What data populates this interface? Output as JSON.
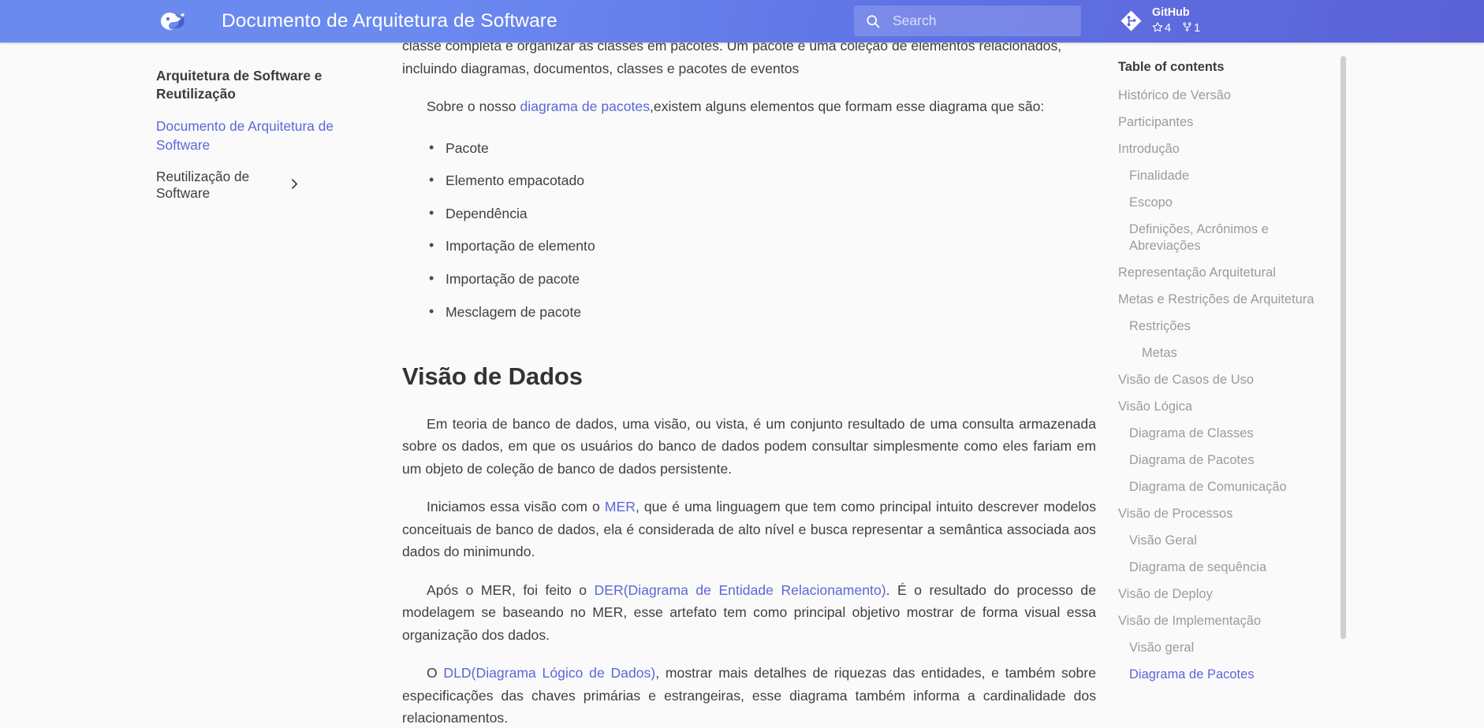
{
  "header": {
    "title": "Documento de Arquitetura de Software",
    "logo_icon": "yin-yang-logo-icon",
    "search": {
      "placeholder": "Search",
      "value": "",
      "icon": "search-icon"
    },
    "repo": {
      "icon": "git-diamond-icon",
      "name": "GitHub",
      "stars_icon": "star-icon",
      "stars": "4",
      "forks_icon": "fork-icon",
      "forks": "1"
    },
    "colors": {
      "gradient_start": "#6b8af0",
      "gradient_end": "#5b62d6",
      "text": "#ffffff"
    }
  },
  "sidebar": {
    "section_title": "Arquitetura de Software e Reutilização",
    "links": [
      {
        "label": "Documento de Arquitetura de Software",
        "active": true
      }
    ],
    "items": [
      {
        "label": "Reutilização de Software",
        "chevron": "chevron-right-icon"
      }
    ]
  },
  "main": {
    "clipped_line": "classe completa e organizar as classes em pacotes. Um pacote é uma coleção de elementos relacionados,",
    "para_continuation": "incluindo diagramas, documentos, classes e pacotes de eventos",
    "para_packages": {
      "before": "Sobre o nosso ",
      "link": "diagrama de pacotes",
      "after": ",existem alguns elementos que formam esse diagrama que são:"
    },
    "bullets": [
      "Pacote",
      "Elemento empacotado",
      "Dependência",
      "Importação de elemento",
      "Importação de pacote",
      "Mesclagem de pacote"
    ],
    "heading": "Visão de Dados",
    "paragraphs": [
      {
        "text": "Em teoria de banco de dados, uma visão, ou vista, é um conjunto resultado de uma consulta armazenada sobre os dados, em que os usuários do banco de dados podem consultar simplesmente como eles fariam em um objeto de coleção de banco de dados persistente."
      },
      {
        "before": "Iniciamos essa visão com o ",
        "link": "MER",
        "after": ", que é uma linguagem que tem como principal intuito descrever modelos conceituais de banco de dados, ela é considerada de alto nível e busca representar a semântica associada aos dados do minimundo."
      },
      {
        "before": "Após o MER, foi feito o ",
        "link": "DER(Diagrama de Entidade Relacionamento)",
        "after": ". É o resultado do processo de modelagem se baseando no MER, esse artefato tem como principal objetivo mostrar de forma visual essa organização dos dados."
      },
      {
        "before": "O ",
        "link": "DLD(Diagrama Lógico de Dados)",
        "after": ", mostrar mais detalhes de riquezas das entidades, e também sobre especificações das chaves primárias e estrangeiras, esse diagrama também informa a cardinalidade dos relacionamentos."
      }
    ]
  },
  "toc": {
    "title": "Table of contents",
    "items": [
      {
        "label": "Histórico de Versão",
        "level": 1,
        "active": false
      },
      {
        "label": "Participantes",
        "level": 1,
        "active": false
      },
      {
        "label": "Introdução",
        "level": 1,
        "active": false
      },
      {
        "label": "Finalidade",
        "level": 2,
        "active": false
      },
      {
        "label": "Escopo",
        "level": 2,
        "active": false
      },
      {
        "label": "Definições, Acrônimos e Abreviações",
        "level": 2,
        "active": false
      },
      {
        "label": "Representação Arquitetural",
        "level": 1,
        "active": false
      },
      {
        "label": "Metas e Restrições de Arquitetura",
        "level": 1,
        "active": false
      },
      {
        "label": "Restrições",
        "level": 2,
        "active": false
      },
      {
        "label": "Metas",
        "level": 3,
        "active": false
      },
      {
        "label": "Visão de Casos de Uso",
        "level": 1,
        "active": false
      },
      {
        "label": "Visão Lógica",
        "level": 1,
        "active": false
      },
      {
        "label": "Diagrama de Classes",
        "level": 2,
        "active": false
      },
      {
        "label": "Diagrama de Pacotes",
        "level": 2,
        "active": false
      },
      {
        "label": "Diagrama de Comunicação",
        "level": 2,
        "active": false
      },
      {
        "label": "Visão de Processos",
        "level": 1,
        "active": false
      },
      {
        "label": "Visão Geral",
        "level": 2,
        "active": false
      },
      {
        "label": "Diagrama de sequência",
        "level": 2,
        "active": false
      },
      {
        "label": "Visão de Deploy",
        "level": 1,
        "active": false
      },
      {
        "label": "Visão de Implementação",
        "level": 1,
        "active": false
      },
      {
        "label": "Visão geral",
        "level": 2,
        "active": false
      },
      {
        "label": "Diagrama de Pacotes",
        "level": 2,
        "active": true
      }
    ]
  }
}
